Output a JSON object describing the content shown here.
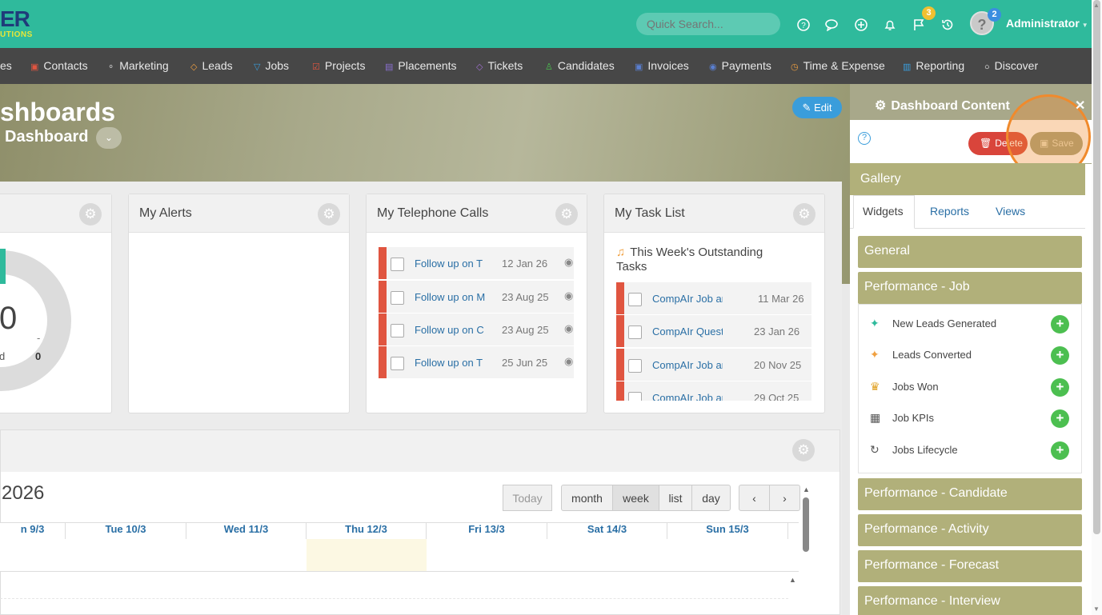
{
  "topbar": {
    "logo_main": "ER",
    "logo_sub": "UTIONS",
    "search_placeholder": "Quick Search...",
    "flag_badge": "3",
    "avatar_badge": "2",
    "user_name": "Administrator",
    "color": "#2fba9c"
  },
  "nav": {
    "items": [
      {
        "label": "es",
        "icon": ""
      },
      {
        "label": "Contacts",
        "icon": "contacts-icon"
      },
      {
        "label": "Marketing",
        "icon": "broadcast-icon"
      },
      {
        "label": "Leads",
        "icon": "diamond-icon"
      },
      {
        "label": "Jobs",
        "icon": "trophy-icon"
      },
      {
        "label": "Projects",
        "icon": "checkbox-icon"
      },
      {
        "label": "Placements",
        "icon": "briefcase-icon"
      },
      {
        "label": "Tickets",
        "icon": "tag-icon"
      },
      {
        "label": "Candidates",
        "icon": "person-icon"
      },
      {
        "label": "Invoices",
        "icon": "invoice-icon"
      },
      {
        "label": "Payments",
        "icon": "coins-icon"
      },
      {
        "label": "Time & Expense",
        "icon": "clock-icon"
      },
      {
        "label": "Reporting",
        "icon": "bar-chart-icon"
      },
      {
        "label": "Discover",
        "icon": "search-icon"
      }
    ]
  },
  "hero": {
    "title": "shboards",
    "subtitle": "Dashboard",
    "edit_label": "Edit"
  },
  "widgets": {
    "gauge_value": "0",
    "gauge_label_left": "d",
    "gauge_label_right": "0",
    "gauge_dash": "-",
    "alerts_title": "My Alerts",
    "calls_title": "My Telephone Calls",
    "calls": [
      {
        "text": "Follow up on T",
        "date": "12 Jan 26"
      },
      {
        "text": "Follow up on M",
        "date": "23 Aug 25"
      },
      {
        "text": "Follow up on C",
        "date": "23 Aug 25"
      },
      {
        "text": "Follow up on T",
        "date": "25 Jun 25"
      }
    ],
    "tasks_title": "My Task List",
    "tasks_heading": "This Week's Outstanding Tasks",
    "tasks": [
      {
        "text": "CompAIr Job and",
        "date": "11 Mar 26"
      },
      {
        "text": "CompAIr Question",
        "date": "23 Jan 26"
      },
      {
        "text": "CompAIr Job and",
        "date": "20 Nov 25"
      },
      {
        "text": "CompAIr Job and",
        "date": "29 Oct 25"
      }
    ]
  },
  "calendar": {
    "title": "2026",
    "today": "Today",
    "views": [
      "month",
      "week",
      "list",
      "day"
    ],
    "prev": "‹",
    "next": "›",
    "days": [
      "n 9/3",
      "Tue 10/3",
      "Wed 11/3",
      "Thu 12/3",
      "Fri 13/3",
      "Sat 14/3",
      "Sun 15/3"
    ]
  },
  "panel": {
    "title": "Dashboard Content",
    "delete_label": "Delete",
    "save_label": "Save",
    "gallery": "Gallery",
    "tabs": [
      "Widgets",
      "Reports",
      "Views"
    ],
    "sections": [
      "General",
      "Performance - Job",
      "Performance - Candidate",
      "Performance - Activity",
      "Performance - Forecast",
      "Performance - Interview"
    ],
    "job_widgets": [
      {
        "label": "New Leads Generated",
        "icon": "sparkle-icon"
      },
      {
        "label": "Leads Converted",
        "icon": "sparkle-icon"
      },
      {
        "label": "Jobs Won",
        "icon": "trophy-icon"
      },
      {
        "label": "Job KPIs",
        "icon": "table-icon"
      },
      {
        "label": "Jobs Lifecycle",
        "icon": "cycle-icon"
      }
    ]
  }
}
